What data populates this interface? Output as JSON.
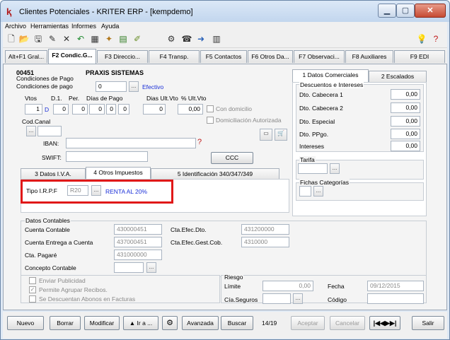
{
  "window": {
    "title": "Clientes Potenciales - KRITER ERP - [kempdemo]"
  },
  "menu": [
    "Archivo",
    "Herramientas",
    "Informes",
    "Ayuda"
  ],
  "tabs": [
    "Alt+F1 Gral...",
    "F2 Condic.G...",
    "F3 Direccio...",
    "F4 Transp.",
    "F5 Contactos",
    "F6 Otros Da...",
    "F7 Observaci...",
    "F8 Auxiliares",
    "F9 EDI"
  ],
  "header": {
    "code": "00451",
    "name": "PRAXIS SISTEMAS"
  },
  "pago": {
    "section_label": "Condiciones de Pago",
    "cond_label": "Condiciones de pago",
    "cond_value": "0",
    "cond_desc": "Efectivo",
    "vtos_label": "Vtos",
    "d1_label": "D.1.",
    "per_label": "Per.",
    "dias_pago_label": "Días de Pago",
    "dias_ult_label": "Dias Ult.Vto",
    "pct_ult_label": "% Ult.Vto",
    "vtos_value": "1",
    "d1_value": "D",
    "per_value": "0",
    "dia1": "0",
    "dia2": "0",
    "dia3": "0",
    "dia4": "0",
    "dias_ult_value": "0",
    "pct_ult_value": "0,00",
    "con_domicilio": "Con domicilio",
    "domiciliacion": "Domiciliación Autorizada",
    "cod_canal_label": "Cod.Canal",
    "iban_label": "IBAN:",
    "swift_label": "SWIFT:",
    "ccc_button": "CCC"
  },
  "subtabs": [
    "3 Datos I.V.A.",
    "4 Otros Impuestos",
    "5 Identificación 340/347/349"
  ],
  "irpf": {
    "label": "Tipo I.R.P.F",
    "code": "R20",
    "desc": "RENTA AL 20%"
  },
  "right_tabs": [
    "1 Datos Comerciales",
    "2 Escalados"
  ],
  "descuentos": {
    "title": "Descuentos e Intereses",
    "rows": [
      {
        "label": "Dto. Cabecera 1",
        "value": "0,00"
      },
      {
        "label": "Dto. Cabecera 2",
        "value": "0,00"
      },
      {
        "label": "Dto. Especial",
        "value": "0,00"
      },
      {
        "label": "Dto. PPgo.",
        "value": "0,00"
      },
      {
        "label": "Intereses",
        "value": "0,00"
      }
    ]
  },
  "tarifa": {
    "title": "Tarifa"
  },
  "fichas": {
    "title": "Fichas Categorías"
  },
  "contables": {
    "title": "Datos Contables",
    "cuenta_contable_label": "Cuenta Contable",
    "cuenta_contable": "430000451",
    "cta_efec_dto_label": "Cta.Efec.Dto.",
    "cta_efec_dto": "431200000",
    "cuenta_entrega_label": "Cuenta Entrega a Cuenta",
    "cuenta_entrega": "437000451",
    "cta_efec_gest_label": "Cta.Efec.Gest.Cob.",
    "cta_efec_gest": "4310000",
    "cta_pagare_label": "Cta. Pagaré",
    "cta_pagare": "431000000",
    "concepto_label": "Concepto Contable"
  },
  "checks": [
    "Enviar Publicidad",
    "Permite Agrupar Recibos.",
    "Se Descuentan Abonos en Facturas"
  ],
  "riesgo": {
    "title": "Riesgo",
    "limite_label": "Límite",
    "limite_value": "0,00",
    "fecha_label": "Fecha",
    "fecha_value": "09/12/2015",
    "cia_label": "Cía.Seguros",
    "codigo_label": "Código"
  },
  "footer": {
    "nuevo": "Nuevo",
    "borrar": "Borrar",
    "modificar": "Modificar",
    "ira": "Ir a ...",
    "avanzada": "Avanzada",
    "buscar": "Buscar",
    "record": "14/19",
    "aceptar": "Aceptar",
    "cancelar": "Cancelar",
    "salir": "Salir"
  },
  "colors": {
    "highlight_box": "#e01818",
    "link_blue": "#1a2fd8"
  }
}
